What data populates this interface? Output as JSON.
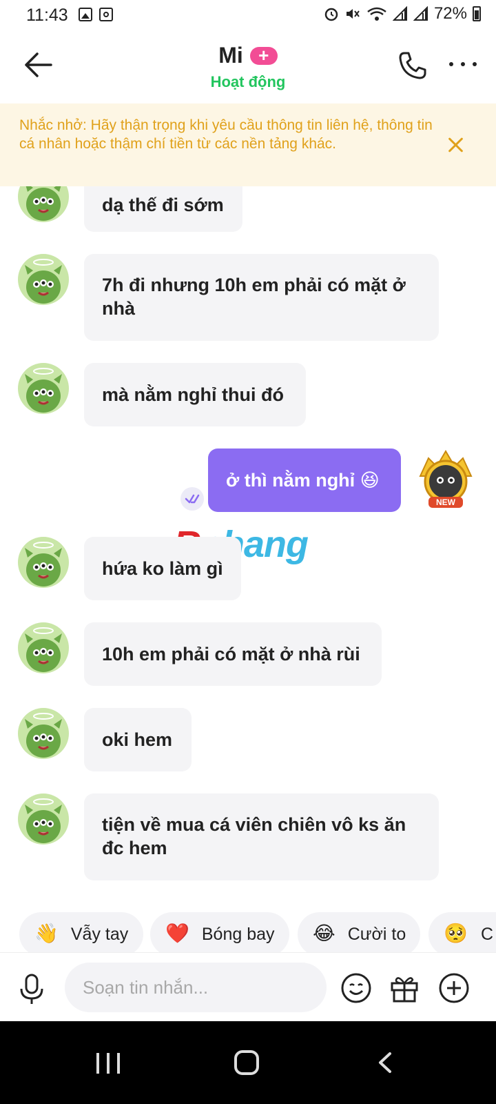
{
  "status_bar": {
    "time": "11:43",
    "battery": "72%"
  },
  "header": {
    "contact_name": "Mi",
    "plus_badge": "+",
    "status": "Hoạt động"
  },
  "warning": {
    "text": "Nhắc nhở: Hãy thận trọng khi yêu cầu thông tin liên hệ, thông tin cá nhân hoặc thậm chí tiền từ các nền tảng khác."
  },
  "messages": [
    {
      "sender": "them",
      "text": "dạ thế đi sớm"
    },
    {
      "sender": "them",
      "text": "7h đi nhưng 10h em phải có mặt ở nhà"
    },
    {
      "sender": "them",
      "text": "mà nằm nghỉ thui đó"
    },
    {
      "sender": "me",
      "text": "ở thì nằm nghỉ 😆"
    },
    {
      "sender": "them",
      "text": "hứa ko làm gì"
    },
    {
      "sender": "them",
      "text": "10h em phải có mặt ở nhà rùi"
    },
    {
      "sender": "them",
      "text": "oki hem"
    },
    {
      "sender": "them",
      "text": "tiện về mua cá viên chiên vô ks ăn đc hem"
    }
  ],
  "my_avatar_badge": "NEW",
  "watermark": {
    "first": "R",
    "rest": "phang"
  },
  "reactions": [
    {
      "emoji": "👋",
      "label": "Vẫy tay"
    },
    {
      "emoji": "❤️",
      "label": "Bóng bay"
    },
    {
      "emoji": "😂",
      "label": "Cười to"
    },
    {
      "emoji": "🥺",
      "label": "C"
    }
  ],
  "input": {
    "placeholder": "Soạn tin nhắn..."
  },
  "colors": {
    "accent": "#8b6cf2",
    "active_status": "#22c55e",
    "warning_text": "#e0a11b",
    "warning_bg": "#fdf6e4",
    "plus_badge": "#f24d95"
  }
}
